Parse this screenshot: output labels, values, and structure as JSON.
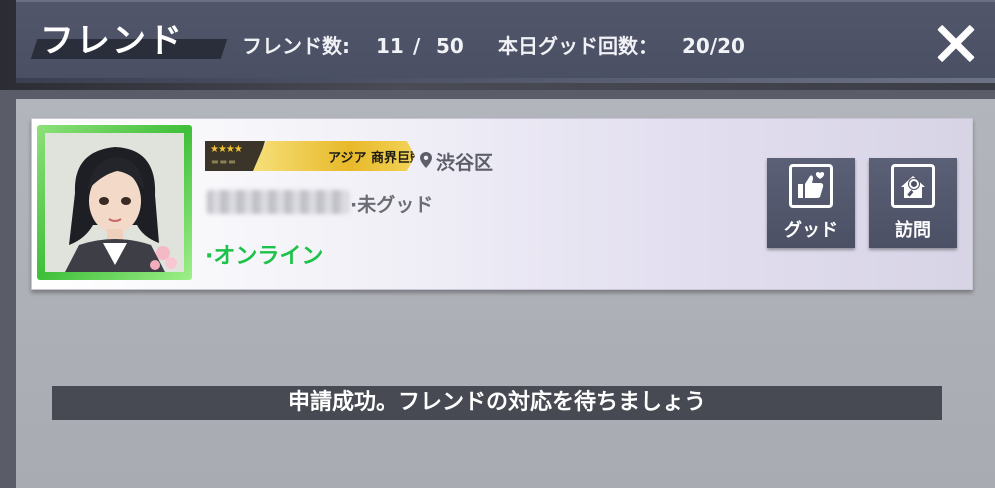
{
  "header": {
    "title": "フレンド",
    "friend_count_label": "フレンド数:",
    "friend_count_current": "11",
    "friend_count_separator": "/",
    "friend_count_max": "50",
    "daily_good_label": "本日グッド回数：",
    "daily_good_value": "20/20"
  },
  "friend_card": {
    "title_badge_text": "アジア 商界巨頭",
    "location": "渋谷区",
    "good_status": "·未グッド",
    "online_status": "·オンライン",
    "buttons": {
      "good_label": "グッド",
      "visit_label": "訪問"
    }
  },
  "toast": {
    "message": "申請成功。フレンドの対応を待ちましょう"
  },
  "colors": {
    "online": "#1ec24a",
    "badge_gold": "#e8b929",
    "header_bg": "#4a4f63",
    "button_bg": "#4c5065"
  }
}
